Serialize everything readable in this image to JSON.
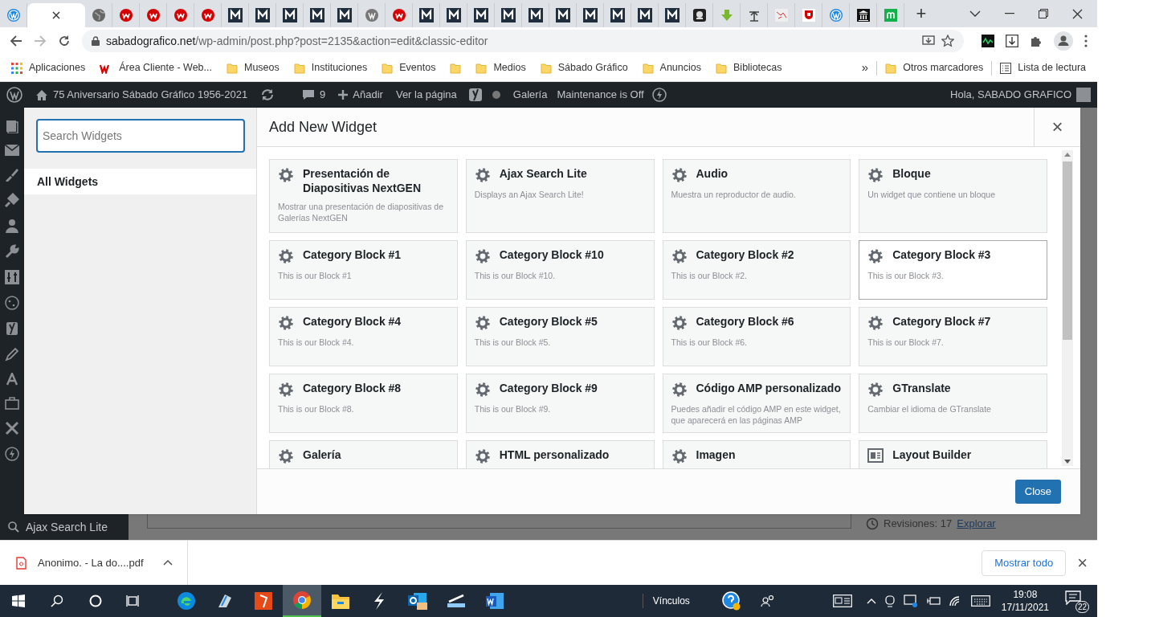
{
  "browser": {
    "tabs": [
      {
        "selected": false
      },
      {
        "selected": true
      },
      {
        "selected": false
      },
      {
        "selected": false
      },
      {
        "selected": false
      },
      {
        "selected": false
      },
      {
        "selected": false
      },
      {
        "selected": false
      },
      {
        "selected": false
      },
      {
        "selected": false
      },
      {
        "selected": false
      },
      {
        "selected": false
      },
      {
        "selected": false
      },
      {
        "selected": false
      },
      {
        "selected": false
      },
      {
        "selected": false
      },
      {
        "selected": false
      },
      {
        "selected": false
      },
      {
        "selected": false
      },
      {
        "selected": false
      },
      {
        "selected": false
      },
      {
        "selected": false
      },
      {
        "selected": false
      },
      {
        "selected": false
      },
      {
        "selected": false
      },
      {
        "selected": false
      },
      {
        "selected": false
      },
      {
        "selected": false
      },
      {
        "selected": false
      },
      {
        "selected": false
      },
      {
        "selected": false
      },
      {
        "selected": false
      }
    ],
    "new_tab": "+",
    "url_host": "sabadografico.net",
    "url_path": "/wp-admin/post.php?post=2135&action=edit&classic-editor",
    "bookmarks": [
      {
        "kind": "apps",
        "label": "Aplicaciones"
      },
      {
        "kind": "w",
        "label": "Área Cliente - Web..."
      },
      {
        "kind": "folder",
        "label": "Museos"
      },
      {
        "kind": "folder",
        "label": "Instituciones"
      },
      {
        "kind": "folder",
        "label": "Eventos"
      },
      {
        "kind": "folder"
      },
      {
        "kind": "folder",
        "label": "Medios"
      },
      {
        "kind": "folder",
        "label": "Sábado Gráfico"
      },
      {
        "kind": "folder",
        "label": "Anuncios"
      },
      {
        "kind": "folder",
        "label": "Bibliotecas"
      }
    ],
    "more": "»",
    "other_bookmarks": "Otros marcadores",
    "reading_list": "Lista de lectura"
  },
  "admin_bar": {
    "site": "75 Aniversario Sábado Gráfico 1956-2021",
    "comments": "9",
    "add": "Añadir",
    "view": "Ver la página",
    "gallery": "Galería",
    "maintenance": "Maintenance is Off",
    "greeting": "Hola, SABADO GRAFICO"
  },
  "admin_menu": {
    "search_item": "Ajax Search Lite"
  },
  "modal": {
    "search": {
      "placeholder": "Search Widgets"
    },
    "all_widgets": "All Widgets",
    "title": "Add New Widget",
    "close_x": "×",
    "widgets": [
      {
        "kind": "gear",
        "title": "Presentación de Diapositivas NextGEN",
        "description": "Mostrar una presentación de diapositivas de Galerías NextGEN",
        "highlighted": false
      },
      {
        "kind": "gear",
        "title": "Ajax Search Lite",
        "description": "Displays an Ajax Search Lite!",
        "highlighted": false
      },
      {
        "kind": "gear",
        "title": "Audio",
        "description": "Muestra un reproductor de audio.",
        "highlighted": false
      },
      {
        "kind": "gear",
        "title": "Bloque",
        "description": "Un widget que contiene un bloque",
        "highlighted": false
      },
      {
        "kind": "gear",
        "title": "Category Block #1",
        "description": "This is our Block #1",
        "highlighted": false
      },
      {
        "kind": "gear",
        "title": "Category Block #10",
        "description": "This is our Block #10.",
        "highlighted": false
      },
      {
        "kind": "gear",
        "title": "Category Block #2",
        "description": "This is our Block #2.",
        "highlighted": false
      },
      {
        "kind": "gear",
        "title": "Category Block #3",
        "description": "This is our Block #3.",
        "highlighted": true
      },
      {
        "kind": "gear",
        "title": "Category Block #4",
        "description": "This is our Block #4.",
        "highlighted": false
      },
      {
        "kind": "gear",
        "title": "Category Block #5",
        "description": "This is our Block #5.",
        "highlighted": false
      },
      {
        "kind": "gear",
        "title": "Category Block #6",
        "description": "This is our Block #6.",
        "highlighted": false
      },
      {
        "kind": "gear",
        "title": "Category Block #7",
        "description": "This is our Block #7.",
        "highlighted": false
      },
      {
        "kind": "gear",
        "title": "Category Block #8",
        "description": "This is our Block #8.",
        "highlighted": false
      },
      {
        "kind": "gear",
        "title": "Category Block #9",
        "description": "This is our Block #9.",
        "highlighted": false
      },
      {
        "kind": "gear",
        "title": "Código AMP personalizado",
        "description": "Puedes añadir el código AMP en este widget, que aparecerá en las páginas AMP",
        "highlighted": false
      },
      {
        "kind": "gear",
        "title": "GTranslate",
        "description": "Cambiar el idioma de GTranslate",
        "highlighted": false
      },
      {
        "kind": "gear",
        "title": "Galería",
        "highlighted": false
      },
      {
        "kind": "gear",
        "title": "HTML personalizado",
        "highlighted": false
      },
      {
        "kind": "gear",
        "title": "Imagen",
        "highlighted": false
      },
      {
        "kind": "layout",
        "title": "Layout Builder",
        "highlighted": false
      }
    ],
    "close_button": "Close"
  },
  "background": {
    "revisions": "Revisiones: 17",
    "explore_link": "Explorar"
  },
  "downloads": {
    "file": "Anonimo. - La do....pdf",
    "show_all": "Mostrar todo",
    "close": "×"
  },
  "taskbar": {
    "apps": [
      {
        "kind": "edge",
        "active": false
      },
      {
        "kind": "scanner",
        "active": false
      },
      {
        "kind": "acrobat",
        "active": false
      },
      {
        "kind": "chrome",
        "active": true
      },
      {
        "kind": "folder",
        "active": false
      },
      {
        "kind": "s",
        "active": false
      },
      {
        "kind": "outlook",
        "active": false
      },
      {
        "kind": "scanner2",
        "active": false
      },
      {
        "kind": "word",
        "active": false
      }
    ],
    "links": "Vínculos",
    "time": "19:08",
    "date": "17/11/2021",
    "notifications": "22"
  }
}
